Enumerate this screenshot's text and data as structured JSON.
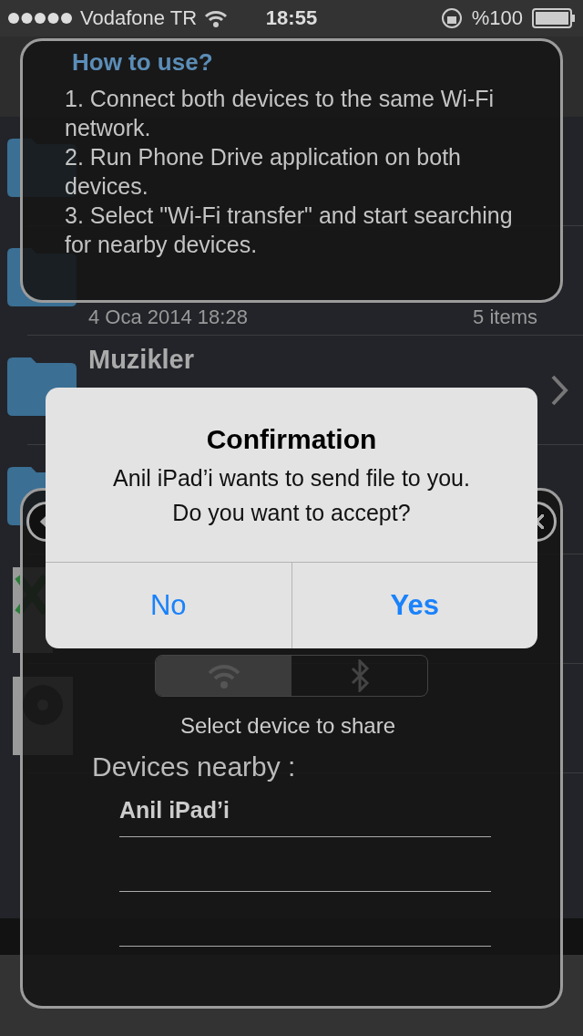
{
  "status_bar": {
    "carrier": "Vodafone TR",
    "time": "18:55",
    "battery": "%100"
  },
  "files": [
    {
      "kind": "folder"
    },
    {
      "kind": "folder",
      "date": "4 Oca 2014 18:28",
      "count": "5 items"
    },
    {
      "kind": "folder",
      "name": "Muzikler"
    },
    {
      "kind": "folder"
    },
    {
      "kind": "xls"
    },
    {
      "kind": "mp3"
    }
  ],
  "help": {
    "title": "How to use?",
    "steps": [
      "1. Connect both devices to the same Wi-Fi network.",
      "2. Run Phone Drive application on both devices.",
      "3. Select \"Wi-Fi transfer\" and start searching for nearby devices."
    ]
  },
  "share": {
    "segments": [
      {
        "kind": "wifi",
        "selected": true
      },
      {
        "kind": "bluetooth",
        "selected": false
      }
    ],
    "prompt": "Select device to share",
    "devices_label": "Devices nearby :",
    "devices": [
      "Anil iPad’i"
    ]
  },
  "alert": {
    "title": "Confirmation",
    "message": [
      "Anil iPad’i wants to send file to you.",
      "Do you want to accept?"
    ],
    "buttons": [
      {
        "label": "No",
        "kind": "normal"
      },
      {
        "label": "Yes",
        "kind": "preferred"
      }
    ]
  }
}
